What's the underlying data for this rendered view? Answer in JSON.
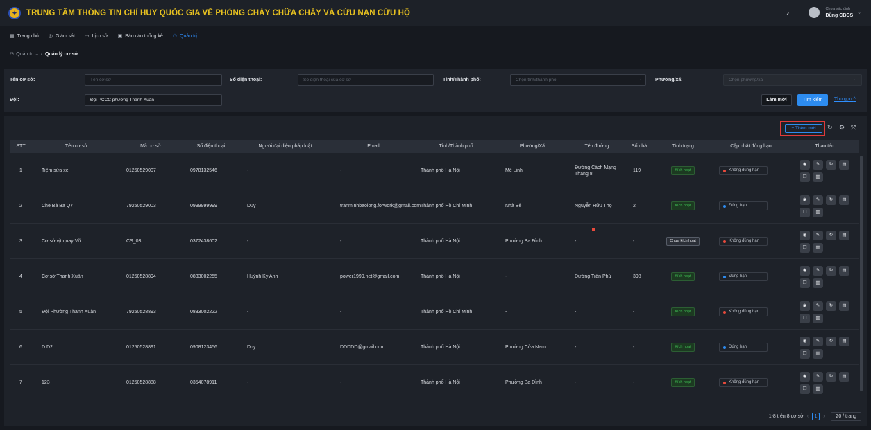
{
  "app": {
    "title": "TRUNG TÂM THÔNG TIN CHỈ HUY QUỐC GIA VỀ PHÒNG CHÁY CHỮA CHÁY VÀ CỨU NẠN CỨU HỘ",
    "logo_icon": "fire-police-emblem"
  },
  "user": {
    "status": "Chưa xác định",
    "name": "Dũng CBCS"
  },
  "nav": [
    {
      "label": "Trang chủ",
      "icon": "grid-icon"
    },
    {
      "label": "Giám sát",
      "icon": "location-icon"
    },
    {
      "label": "Lịch sử",
      "icon": "monitor-icon"
    },
    {
      "label": "Báo cáo thống kê",
      "icon": "report-icon"
    },
    {
      "label": "Quản trị",
      "icon": "user-icon",
      "active": true
    }
  ],
  "breadcrumb": {
    "parent": "Quản trị",
    "current": "Quản lý cơ sở"
  },
  "filters": {
    "name_label": "Tên cơ sở:",
    "name_placeholder": "Tên cơ sở",
    "phone_label": "Số điện thoại:",
    "phone_placeholder": "Số điện thoại của cơ sở",
    "province_label": "Tỉnh/Thành phố:",
    "province_placeholder": "Chọn tỉnh/thành phố",
    "ward_label": "Phường/xã:",
    "ward_placeholder": "Chọn phường/xã",
    "team_label": "Đội:",
    "team_value": "Đội PCCC phường Thanh Xuân",
    "reset_label": "Làm mới",
    "search_label": "Tìm kiếm",
    "collapse_label": "Thu gọn"
  },
  "toolbar": {
    "add_label": "+ Thêm mới"
  },
  "columns": [
    "STT",
    "Tên cơ sở",
    "Mã cơ sở",
    "Số điện thoại",
    "Người đại diện pháp luật",
    "Email",
    "Tỉnh/Thành phố",
    "Phường/Xã",
    "Tên đường",
    "Số nhà",
    "Tình trạng",
    "Cập nhật đúng hạn",
    "Thao tác"
  ],
  "rows": [
    {
      "stt": "1",
      "name": "Tiệm sửa xe",
      "code": "01250529007",
      "phone": "0978132546",
      "rep": "-",
      "email": "-",
      "province": "Thành phố Hà Nội",
      "ward": "Mê Linh",
      "street": "Đường Cách Mạng Tháng 8",
      "house": "119",
      "status": "Kích hoạt",
      "status_active": true,
      "due": "Không đúng hạn",
      "due_ok": false
    },
    {
      "stt": "2",
      "name": "Chè Bà Ba Q7",
      "code": "79250529003",
      "phone": "0999999999",
      "rep": "Duy",
      "email": "tranminhbaolong.forwork@gmail.com",
      "province": "Thành phố Hồ Chí Minh",
      "ward": "Nhà Bè",
      "street": "Nguyễn Hữu Thọ",
      "house": "2",
      "status": "Kích hoạt",
      "status_active": true,
      "due": "Đúng hạn",
      "due_ok": true
    },
    {
      "stt": "3",
      "name": "Cơ sở vịt quay Vũ",
      "code": "CS_03",
      "phone": "0372438602",
      "rep": "-",
      "email": "-",
      "province": "Thành phố Hà Nội",
      "ward": "Phường Ba Đình",
      "street": "-",
      "house": "-",
      "status": "Chưa kích hoạt",
      "status_active": false,
      "due": "Không đúng hạn",
      "due_ok": false
    },
    {
      "stt": "4",
      "name": "Cơ sở Thanh Xuân",
      "code": "01250528894",
      "phone": "0833002255",
      "rep": "Huỳnh Kỳ Anh",
      "email": "power1999.net@gmail.com",
      "province": "Thành phố Hà Nội",
      "ward": "-",
      "street": "Đường Trần Phú",
      "house": "398",
      "status": "Kích hoạt",
      "status_active": true,
      "due": "Đúng hạn",
      "due_ok": true
    },
    {
      "stt": "5",
      "name": "Đội Phường Thanh Xuân",
      "code": "79250528893",
      "phone": "0833002222",
      "rep": "-",
      "email": "-",
      "province": "Thành phố Hồ Chí Minh",
      "ward": "-",
      "street": "-",
      "house": "-",
      "status": "Kích hoạt",
      "status_active": true,
      "due": "Không đúng hạn",
      "due_ok": false
    },
    {
      "stt": "6",
      "name": "D D2",
      "code": "01250528891",
      "phone": "0908123456",
      "rep": "Duy",
      "email": "DDDDD@gmail.com",
      "province": "Thành phố Hà Nội",
      "ward": "Phường Cửa Nam",
      "street": "-",
      "house": "-",
      "status": "Kích hoạt",
      "status_active": true,
      "due": "Đúng hạn",
      "due_ok": true
    },
    {
      "stt": "7",
      "name": "123",
      "code": "01250528888",
      "phone": "0354078911",
      "rep": "-",
      "email": "-",
      "province": "Thành phố Hà Nội",
      "ward": "Phường Ba Đình",
      "street": "-",
      "house": "-",
      "status": "Kích hoạt",
      "status_active": true,
      "due": "Không đúng hạn",
      "due_ok": false
    }
  ],
  "actions": [
    "view-icon",
    "edit-icon",
    "refresh-icon",
    "print-icon",
    "copy-icon",
    "delete-icon"
  ],
  "pagination": {
    "summary": "1-8 trên 8 cơ sở",
    "current": "1",
    "page_size": "20 / trang"
  },
  "colors": {
    "brand_title": "#e6c020",
    "accent": "#2d8cf0",
    "active_green": "#3fbf54",
    "due_red": "#e84a3c",
    "highlight_border": "#e03a3a"
  }
}
